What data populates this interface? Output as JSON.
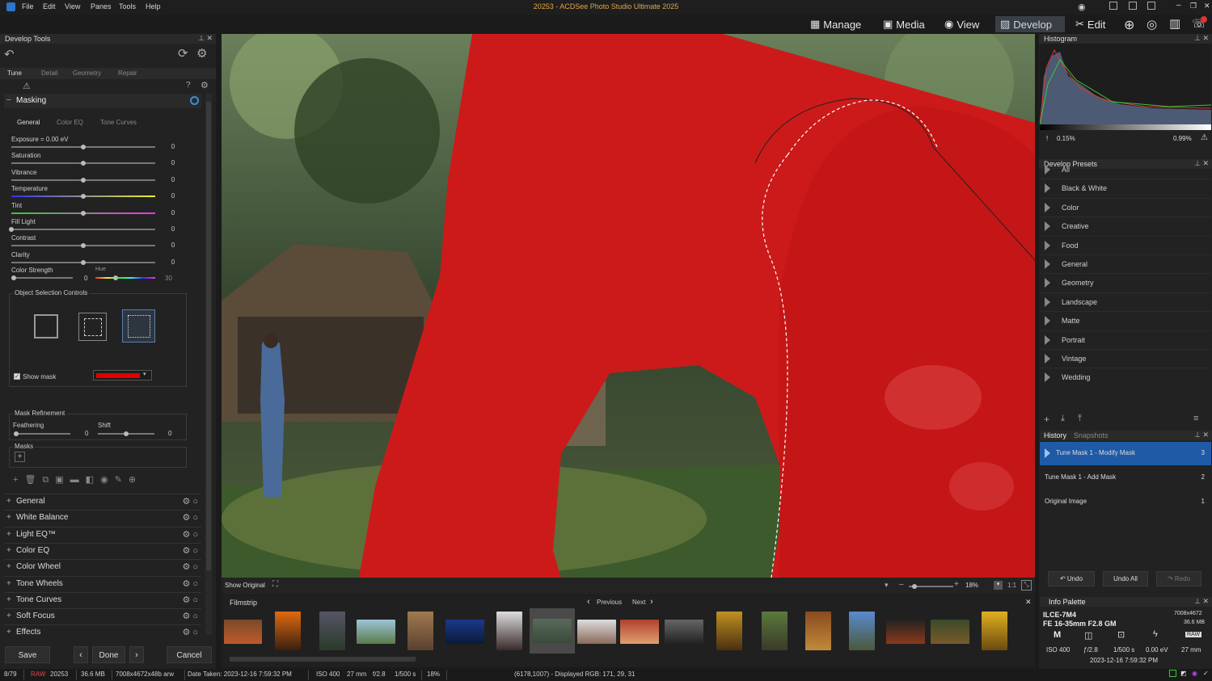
{
  "window": {
    "title": "20253 - ACDSee Photo Studio Ultimate 2025",
    "menus": [
      "File",
      "Edit",
      "View",
      "Panes",
      "Tools",
      "Help"
    ]
  },
  "modes": [
    {
      "label": "Manage",
      "icon": "grid-icon"
    },
    {
      "label": "Media",
      "icon": "film-icon"
    },
    {
      "label": "View",
      "icon": "eye-icon"
    },
    {
      "label": "Develop",
      "icon": "develop-icon",
      "active": true
    },
    {
      "label": "Edit",
      "icon": "tools-icon"
    }
  ],
  "left": {
    "title": "Develop Tools",
    "tabs": [
      "Tune",
      "Detail",
      "Geometry",
      "Repair"
    ],
    "masking": {
      "title": "Masking",
      "subtabs": [
        "General",
        "Color EQ",
        "Tone Curves"
      ],
      "sliders": [
        {
          "label": "Exposure = 0.00 eV",
          "value": "0",
          "pos": 0.5
        },
        {
          "label": "Saturation",
          "value": "0",
          "pos": 0.5
        },
        {
          "label": "Vibrance",
          "value": "0",
          "pos": 0.5
        },
        {
          "label": "Temperature",
          "value": "0",
          "pos": 0.5
        },
        {
          "label": "Tint",
          "value": "0",
          "pos": 0.5
        },
        {
          "label": "Fill Light",
          "value": "0",
          "pos": 0.0
        },
        {
          "label": "Contrast",
          "value": "0",
          "pos": 0.5
        },
        {
          "label": "Clarity",
          "value": "0",
          "pos": 0.5
        }
      ],
      "color_strength": {
        "label": "Color Strength",
        "value": "0",
        "hue_label": "Hue",
        "hue_value": "30"
      },
      "object_selection": {
        "title": "Object Selection Controls",
        "show_mask": "Show mask",
        "mask_color": "#e00000"
      },
      "refinement": {
        "title": "Mask Refinement",
        "feathering_label": "Feathering",
        "feathering_value": "0",
        "shift_label": "Shift",
        "shift_value": "0"
      },
      "masks_label": "Masks"
    },
    "sections": [
      "General",
      "White Balance",
      "Light EQ™",
      "Color EQ",
      "Color Wheel",
      "Tone Wheels",
      "Tone Curves",
      "Soft Focus",
      "Effects"
    ],
    "buttons": {
      "save": "Save",
      "done": "Done",
      "cancel": "Cancel"
    }
  },
  "viewer": {
    "show_original": "Show Original",
    "zoom": "18%",
    "ratio": "1:1"
  },
  "filmstrip": {
    "title": "Filmstrip",
    "prev": "Previous",
    "next": "Next"
  },
  "right": {
    "histogram": {
      "title": "Histogram",
      "low": "0.15%",
      "high": "0.99%"
    },
    "presets": {
      "title": "Develop Presets",
      "items": [
        "All",
        "Black & White",
        "Color",
        "Creative",
        "Food",
        "General",
        "Geometry",
        "Landscape",
        "Matte",
        "Portrait",
        "Vintage",
        "Wedding"
      ]
    },
    "history": {
      "tab1": "History",
      "tab2": "Snapshots",
      "items": [
        {
          "label": "Tune Mask 1 - Modify Mask",
          "n": "3",
          "active": true
        },
        {
          "label": "Tune Mask 1 - Add Mask",
          "n": "2"
        },
        {
          "label": "Original Image",
          "n": "1"
        }
      ],
      "undo": "Undo",
      "undo_all": "Undo All",
      "redo": "Redo"
    },
    "info": {
      "title": "Info Palette",
      "camera": "ILCE-7M4",
      "lens": "FE 16-35mm F2.8 GM",
      "dims": "7008x4672",
      "size": "36.6 MB",
      "mode": "M",
      "iso": "ISO 400",
      "aperture": "ƒ/2.8",
      "shutter": "1/500 s",
      "ev": "0.00 eV",
      "focal": "27 mm",
      "date": "2023-12-16 7:59:32 PM"
    }
  },
  "status": {
    "count": "8/79",
    "raw": "RAW",
    "name": "20253",
    "size": "36.6 MB",
    "dims": "7008x4672x48b arw",
    "date": "Date Taken: 2023-12-16 7:59:32 PM",
    "iso": "ISO 400",
    "focal": "27 mm",
    "ap": "f/2.8",
    "shutter": "1/500 s",
    "zoom": "18%",
    "pixel": "(6178,1007) - Displayed RGB: 171, 29, 31"
  }
}
